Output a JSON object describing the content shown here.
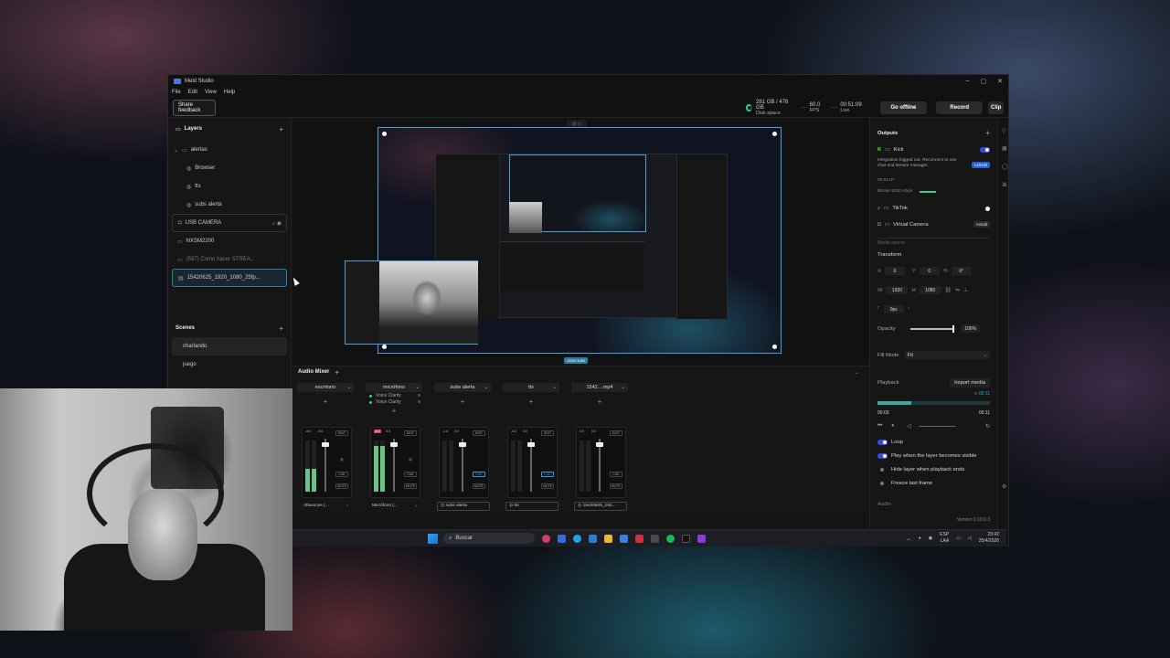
{
  "window": {
    "title": "Meld Studio",
    "menu": [
      "File",
      "Edit",
      "View",
      "Help"
    ],
    "controls": [
      "–",
      "▢",
      "✕"
    ]
  },
  "toolbar": {
    "share_feedback": "Share feedback",
    "disk_value": "281 GB / 476 GB",
    "disk_label": "Disk space",
    "fps_value": "60.0",
    "fps_label": "FPS",
    "live_value": "00:51:09",
    "live_label": "Live",
    "go_offline": "Go offline",
    "record": "Record",
    "clip": "Clip"
  },
  "layers": {
    "title": "Layers",
    "items": [
      {
        "label": "alertas"
      },
      {
        "label": "Browser"
      },
      {
        "label": "tts"
      },
      {
        "label": "subs alerta"
      },
      {
        "label": "USB CAMERA"
      },
      {
        "label": "NXSM2200"
      },
      {
        "label": "(597) Como hacer STREA..."
      },
      {
        "label": "15420625_1920_1080_25fp..."
      }
    ]
  },
  "scenes": {
    "title": "Scenes",
    "items": [
      {
        "label": "charlando"
      },
      {
        "label": "juego"
      }
    ]
  },
  "canvas": {
    "dimensions": "1920×1080"
  },
  "mixer": {
    "title": "Audio Mixer",
    "strips": [
      {
        "name": "escritorio",
        "device": "Altavoces (...",
        "lvl_left": "-9.6",
        "lvl_right": "-9.6",
        "level": 0.45
      },
      {
        "name": "micrófono",
        "device": "Micrófono (...",
        "lvl_left": "-0.2",
        "lvl_right": "0.0",
        "level": 0.9,
        "filters": [
          "Voice Clarity",
          "Voice Clarity"
        ]
      },
      {
        "name": "subs alerta",
        "device": "subs alerta",
        "lvl_left": "-1.4",
        "lvl_right": "0.0",
        "level": 0
      },
      {
        "name": "tts",
        "device": "tts",
        "lvl_left": "-4.2",
        "lvl_right": "0.0",
        "level": 0
      },
      {
        "name": "1542....mp4",
        "device": "15420625_192...",
        "lvl_left": "0.0",
        "lvl_right": "0.0",
        "level": 0
      }
    ],
    "btn_edit": "EDIT",
    "btn_cue": "CUE",
    "btn_mute": "MUTE"
  },
  "outputs": {
    "title": "Outputs",
    "kick": "Kick",
    "integration_msg": "Integration logged out. Reconnect to use chat and stream manager.",
    "login": "LOGIN",
    "kick_time": "00:51:07",
    "bitrate": "Bitrate  5230 Kbps",
    "tiktok": "TikTok",
    "virtual_camera": "Virtual Camera",
    "install": "Install",
    "media_source": "Media source"
  },
  "transform": {
    "title": "Transform",
    "x_label": "X",
    "x": "0",
    "y_label": "Y",
    "y": "0",
    "rot": "0°",
    "w_label": "W",
    "w": "1920",
    "h_label": "H",
    "h": "1080",
    "radius": "0px",
    "opacity_label": "Opacity",
    "opacity": "100%",
    "opacity_level": 1.0
  },
  "fill_mode": {
    "label": "Fill Mode",
    "value": "Fit"
  },
  "playback": {
    "title": "Playback",
    "import": "Import media",
    "remaining": "∞ 00:11",
    "current": "00:03",
    "total": "00:11",
    "progress": 0.3,
    "loop": "Loop",
    "play_visible": "Play when the layer becomes visible",
    "hide_end": "Hide layer when playback ends",
    "freeze": "Freeze last frame",
    "audio": "Audio"
  },
  "version": "Version 0.10.0.3",
  "taskbar": {
    "search": "Buscar",
    "lang_top": "ESP",
    "lang_bottom": "LAA",
    "time": "23:42",
    "date": "25/4/2026"
  },
  "colors": {
    "accent": "#2563d8",
    "selection": "#4aa0d8",
    "meter": "#6ac28a",
    "live": "#2fd28a"
  }
}
